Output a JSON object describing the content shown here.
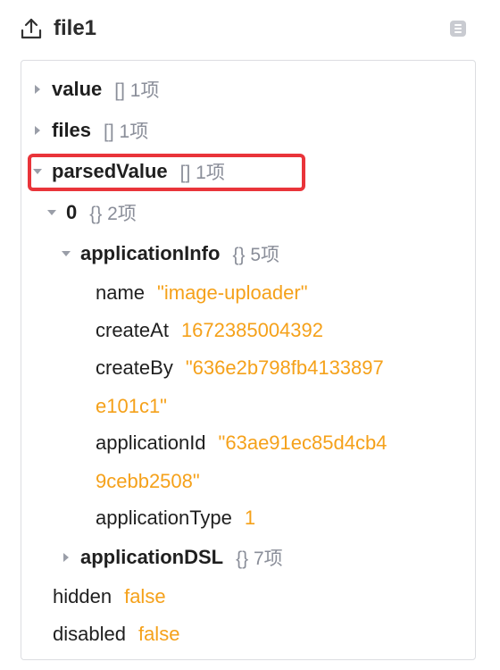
{
  "header": {
    "title": "file1",
    "upload_icon": "upload-icon",
    "menu_icon": "menu-icon"
  },
  "tree": {
    "value": {
      "key": "value",
      "meta": "[] 1项",
      "expanded": false
    },
    "files": {
      "key": "files",
      "meta": "[] 1项",
      "expanded": false
    },
    "parsedValue": {
      "key": "parsedValue",
      "meta": "[] 1项",
      "expanded": true
    },
    "item0": {
      "key": "0",
      "meta": "{} 2项",
      "expanded": true
    },
    "applicationInfo": {
      "key": "applicationInfo",
      "meta": "{} 5项",
      "expanded": true,
      "name": {
        "key": "name",
        "value": "\"image-uploader\""
      },
      "createAt": {
        "key": "createAt",
        "value": "1672385004392"
      },
      "createBy": {
        "key": "createBy",
        "value_line1": "\"636e2b798fb4133897",
        "value_line2": "e101c1\""
      },
      "applicationId": {
        "key": "applicationId",
        "value_line1": "\"63ae91ec85d4cb4",
        "value_line2": "9cebb2508\""
      },
      "applicationType": {
        "key": "applicationType",
        "value": "1"
      }
    },
    "applicationDSL": {
      "key": "applicationDSL",
      "meta": "{} 7项",
      "expanded": false
    },
    "hidden": {
      "key": "hidden",
      "value": "false"
    },
    "disabled": {
      "key": "disabled",
      "value": "false"
    }
  },
  "colors": {
    "highlight_border": "#e9343a",
    "value_orange": "#f5a11a",
    "meta_gray": "#8a8e99"
  }
}
